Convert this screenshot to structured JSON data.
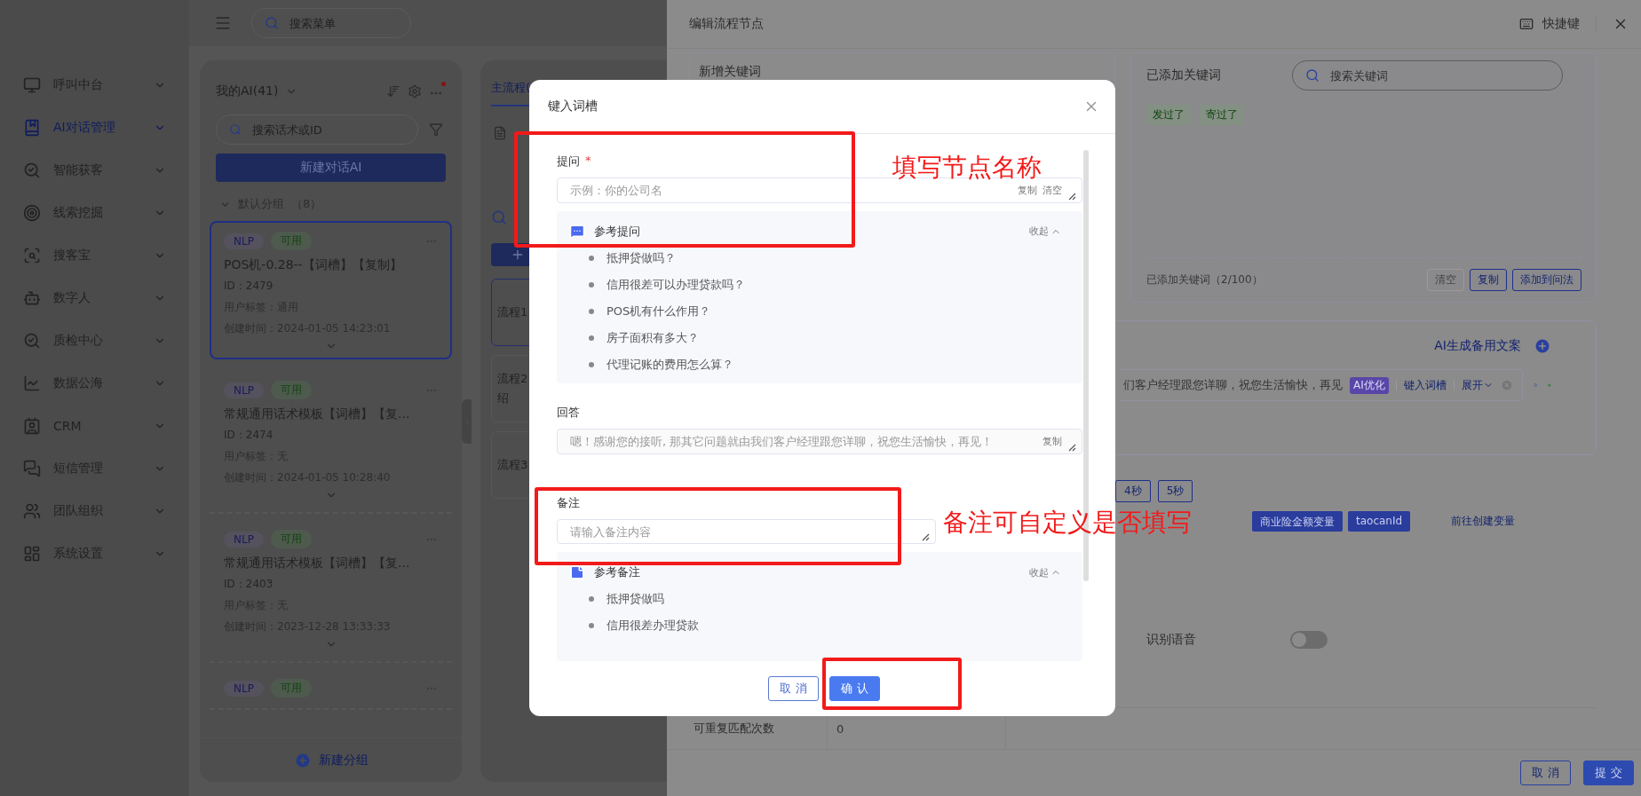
{
  "topbar": {
    "search_placeholder": "搜索菜单"
  },
  "sidebar": {
    "items": [
      {
        "label": "呼叫中台",
        "selected": false
      },
      {
        "label": "AI对话管理",
        "selected": true
      },
      {
        "label": "智能获客",
        "selected": false
      },
      {
        "label": "线索挖掘",
        "selected": false
      },
      {
        "label": "搜客宝",
        "selected": false
      },
      {
        "label": "数字人",
        "selected": false
      },
      {
        "label": "质检中心",
        "selected": false
      },
      {
        "label": "数据公海",
        "selected": false
      },
      {
        "label": "CRM",
        "selected": false
      },
      {
        "label": "短信管理",
        "selected": false
      },
      {
        "label": "团队组织",
        "selected": false
      },
      {
        "label": "系统设置",
        "selected": false
      }
    ]
  },
  "ai_list": {
    "title": "我的AI(41)",
    "search_placeholder": "搜索话术或ID",
    "new_button": "新建对话AI",
    "group": {
      "label": "默认分组",
      "count": "（8）"
    },
    "cards": [
      {
        "selected": true,
        "tags": [
          {
            "kind": "type",
            "text": "NLP"
          },
          {
            "kind": "status",
            "text": "可用"
          }
        ],
        "name": "POS机-0.28--【词槽】【复制】",
        "id": "ID：2479",
        "user_tag": "用户标签：通用",
        "created": "创建时间：2024-01-05 14:23:01"
      },
      {
        "selected": false,
        "tags": [
          {
            "kind": "type",
            "text": "NLP"
          },
          {
            "kind": "status",
            "text": "可用"
          }
        ],
        "name": "常规通用话术模板【词槽】【复...",
        "id": "ID：2474",
        "user_tag": "用户标签：无",
        "created": "创建时间：2024-01-05 10:28:40"
      },
      {
        "selected": false,
        "tags": [
          {
            "kind": "type",
            "text": "NLP"
          },
          {
            "kind": "status",
            "text": "可用"
          }
        ],
        "name": "常规通用话术模板【词槽】【复...",
        "id": "ID：2403",
        "user_tag": "用户标签：无",
        "created": "创建时间：2023-12-28 13:33:33"
      },
      {
        "selected": false,
        "tags": [
          {
            "kind": "type",
            "text": "NLP"
          },
          {
            "kind": "status",
            "text": "可用"
          }
        ]
      }
    ],
    "footer_button": "新建分组"
  },
  "flow_panel": {
    "tabs": [
      {
        "label": "主流程(",
        "selected": true
      }
    ],
    "flows": [
      {
        "lines": [
          "流程1"
        ]
      },
      {
        "lines": [
          "流程2",
          "绍"
        ]
      },
      {
        "lines": [
          "流程3"
        ]
      }
    ]
  },
  "drawer": {
    "title": "编辑流程节点",
    "shortcut": "快捷键",
    "new_keywords_title": "新增关键词",
    "added_keywords": {
      "title": "已添加关键词",
      "search_placeholder": "搜索关键词",
      "tags": [
        "发过了",
        "寄过了"
      ],
      "count": "已添加关键词（2/100）",
      "buttons": [
        {
          "label": "清空",
          "kind": "plain"
        },
        {
          "label": "复制",
          "kind": "outline"
        },
        {
          "label": "添加到问法",
          "kind": "outline"
        }
      ]
    },
    "backup": {
      "ai_generate": "AI生成备用文案",
      "text": "们客户经理跟您详聊，祝您生活愉快，再见",
      "ai_optimize": "AI优化",
      "insert_slot": "键入词槽",
      "expand": "展开"
    },
    "wait_buttons": [
      "4秒",
      "5秒"
    ],
    "variables": [
      {
        "kind": "tag",
        "label": "商业险金额变量"
      },
      {
        "kind": "tag",
        "label": "taocanId"
      }
    ],
    "create_variable_link": "前往创建变量",
    "voice": {
      "label": "识别语音",
      "on": false
    },
    "repeat": {
      "label": "可重复匹配次数",
      "value": "0"
    },
    "footer": [
      {
        "label": "取 消",
        "kind": "outline"
      },
      {
        "label": "提 交",
        "kind": "primary"
      }
    ]
  },
  "modal": {
    "title": "键入词槽",
    "question": {
      "label": "提问",
      "required_mark": "*",
      "placeholder": "示例：你的公司名",
      "actions": [
        "复制",
        "清空"
      ]
    },
    "question_refs": {
      "title": "参考提问",
      "collapse": "收起",
      "items": [
        "抵押贷做吗？",
        "信用很差可以办理贷款吗？",
        "POS机有什么作用？",
        "房子面积有多大？",
        "代理记账的费用怎么算？"
      ]
    },
    "answer": {
      "label": "回答",
      "placeholder": "嗯！感谢您的接听, 那其它问题就由我们客户经理跟您详聊，祝您生活愉快，再见！",
      "actions": [
        "复制"
      ]
    },
    "note": {
      "label": "备注",
      "placeholder": "请输入备注内容"
    },
    "note_refs": {
      "title": "参考备注",
      "collapse": "收起",
      "items": [
        "抵押贷做吗",
        "信用很差办理贷款"
      ]
    },
    "buttons": [
      {
        "label": "取 消",
        "kind": "outline"
      },
      {
        "label": "确 认",
        "kind": "primary"
      }
    ]
  },
  "annotations": {
    "labels": [
      "填写节点名称",
      "备注可自定义是否填写"
    ]
  }
}
